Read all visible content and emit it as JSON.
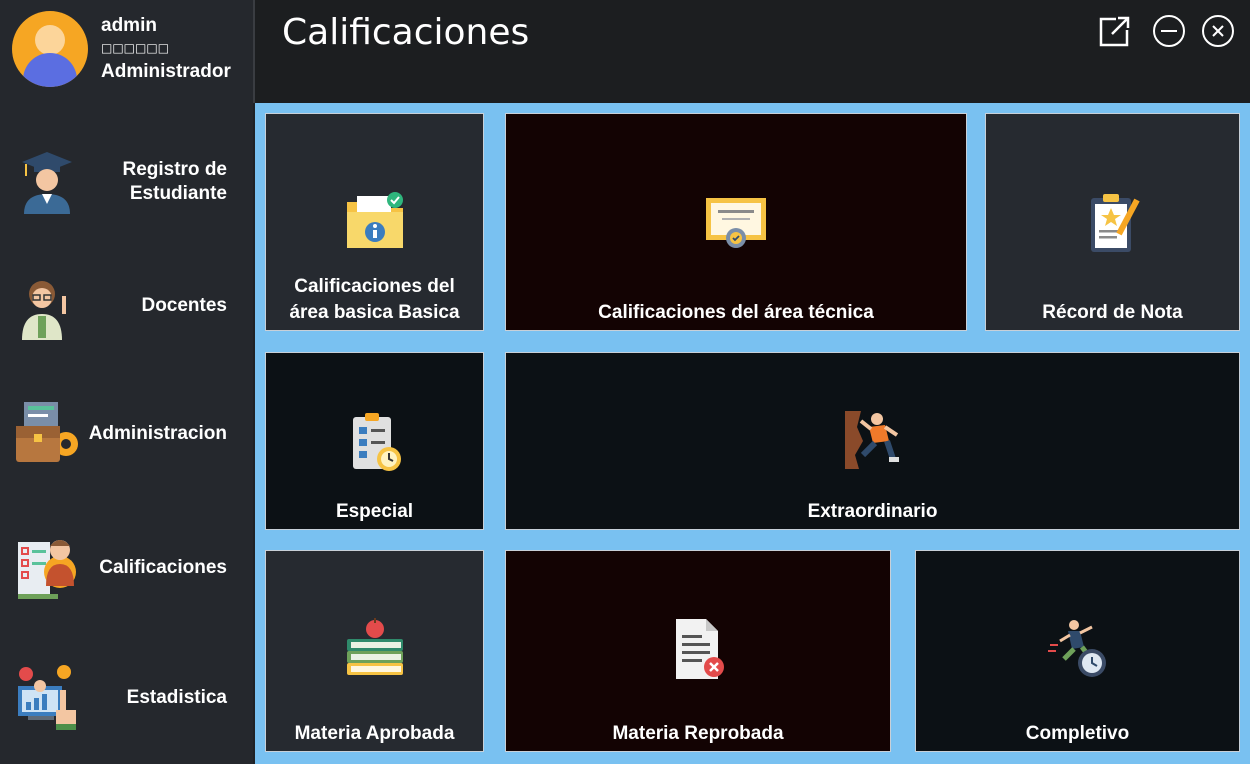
{
  "profile": {
    "username": "admin",
    "status_glyphs": "□□□□□□",
    "role": "Administrador"
  },
  "sidebar": {
    "items": [
      {
        "label": "Registro de Estudiante",
        "icon": "student-graduate-icon"
      },
      {
        "label": "Docentes",
        "icon": "teacher-icon"
      },
      {
        "label": "Administracion",
        "icon": "briefcase-gear-icon"
      },
      {
        "label": "Calificaciones",
        "icon": "grades-teacher-icon"
      },
      {
        "label": "Estadistica",
        "icon": "statistics-dashboard-icon"
      }
    ]
  },
  "header": {
    "title": "Calificaciones",
    "buttons": [
      "popout-icon",
      "minimize-icon",
      "close-icon"
    ]
  },
  "tiles": [
    {
      "label_line1": "Calificaciones del",
      "label_line2": "área basica Basica",
      "icon": "folder-info-icon"
    },
    {
      "label": "Calificaciones del área técnica",
      "icon": "certificate-icon"
    },
    {
      "label": "Récord de Nota",
      "icon": "clipboard-star-icon"
    },
    {
      "label": "Especial",
      "icon": "checklist-clock-icon"
    },
    {
      "label": "Extraordinario",
      "icon": "climber-icon"
    },
    {
      "label": "Materia Aprobada",
      "icon": "books-apple-icon"
    },
    {
      "label": "Materia Reprobada",
      "icon": "document-fail-icon"
    },
    {
      "label": "Completivo",
      "icon": "runner-clock-icon"
    }
  ],
  "colors": {
    "sidebar_bg": "#25282d",
    "header_bg": "#1c1e20",
    "content_bg": "#79c1f1",
    "tile_gray": "#262a30",
    "tile_maroon": "#130303",
    "tile_dark": "#0c1115"
  }
}
